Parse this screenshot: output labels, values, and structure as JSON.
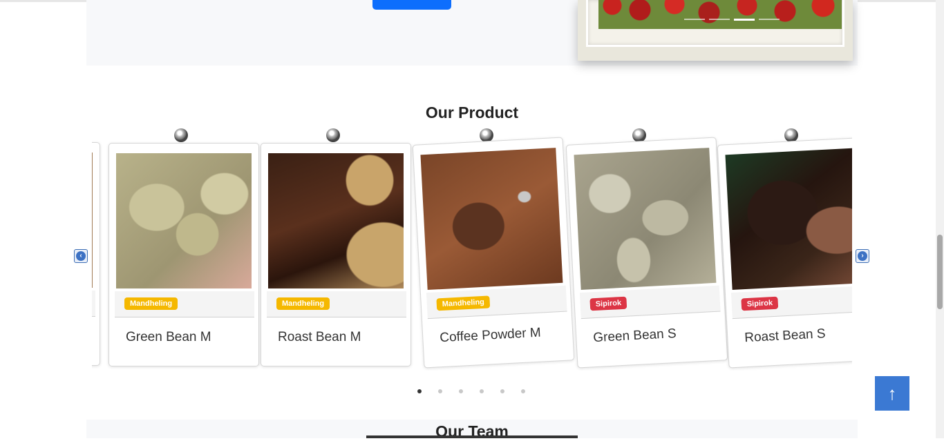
{
  "hero": {
    "button_label": "",
    "slide_count": 4,
    "active_slide": 3
  },
  "products_section": {
    "title": "Our Product",
    "prev_label": "‹",
    "next_label": "›",
    "items": [
      {
        "name": "Green Bean M",
        "badge": "Mandheling",
        "badge_color": "#f5b800",
        "image": "green-coffee-beans"
      },
      {
        "name": "Roast Bean M",
        "badge": "Mandheling",
        "badge_color": "#f5b800",
        "image": "roasted-coffee-beans-sack"
      },
      {
        "name": "Coffee Powder M",
        "badge": "Mandheling",
        "badge_color": "#f5b800",
        "image": "ground-coffee-spoon"
      },
      {
        "name": "Green Bean S",
        "badge": "Sipirok",
        "badge_color": "#dc3545",
        "image": "green-coffee-beans"
      },
      {
        "name": "Roast Bean S",
        "badge": "Sipirok",
        "badge_color": "#dc3545",
        "image": "roasted-beans-in-hands"
      }
    ],
    "page_count": 6,
    "active_page": 1
  },
  "team_section": {
    "title": "Our Team"
  },
  "scroll_top": {
    "icon": "arrow-up-icon",
    "label": "↑"
  },
  "colors": {
    "primary": "#0d6efd",
    "scroll_button": "#3b79d3",
    "badge_yellow": "#f5b800",
    "badge_red": "#dc3545"
  }
}
